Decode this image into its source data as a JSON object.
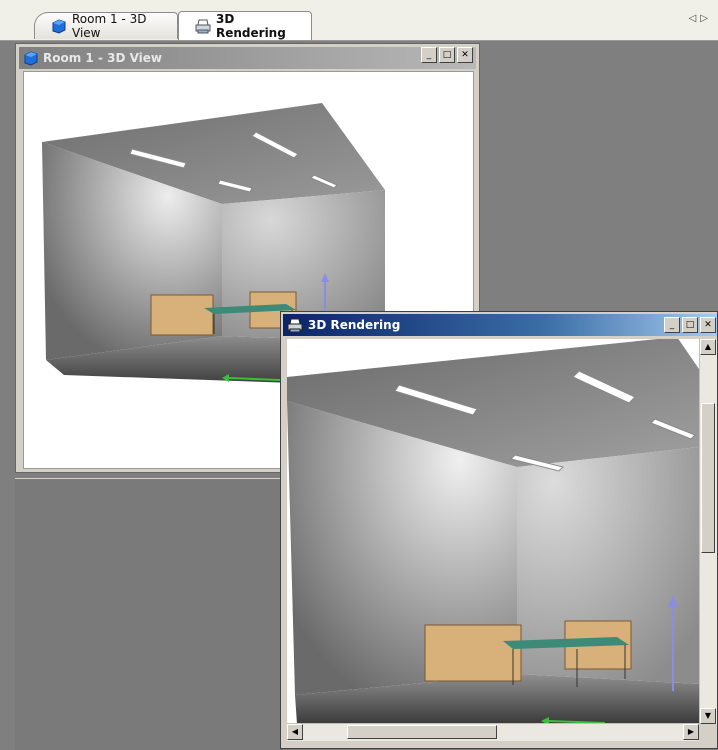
{
  "tabs": [
    {
      "label": "Room 1 - 3D View",
      "icon": "cube-icon",
      "active": false
    },
    {
      "label": "3D Rendering",
      "icon": "printer-icon",
      "active": true
    }
  ],
  "nav": {
    "prev": "◁",
    "next": "▷"
  },
  "window_3d_view": {
    "title": "Room 1 - 3D View",
    "icon": "cube-icon",
    "controls": {
      "minimize": "_",
      "maximize": "□",
      "close": "✕"
    }
  },
  "window_rendering": {
    "title": "3D Rendering",
    "icon": "printer-icon",
    "controls": {
      "minimize": "_",
      "maximize": "□",
      "close": "✕"
    },
    "scroll_arrows": {
      "up": "▲",
      "down": "▼",
      "left": "◀",
      "right": "▶"
    }
  },
  "colors": {
    "workspace": "#7f7f7f",
    "active_caption": "#0a246a",
    "inactive_caption": "#808080",
    "axis_up": "#8a8ee0",
    "axis_x": "#3bbf3b",
    "furniture": "#d8b07a",
    "table_top": "#3c8a78"
  }
}
